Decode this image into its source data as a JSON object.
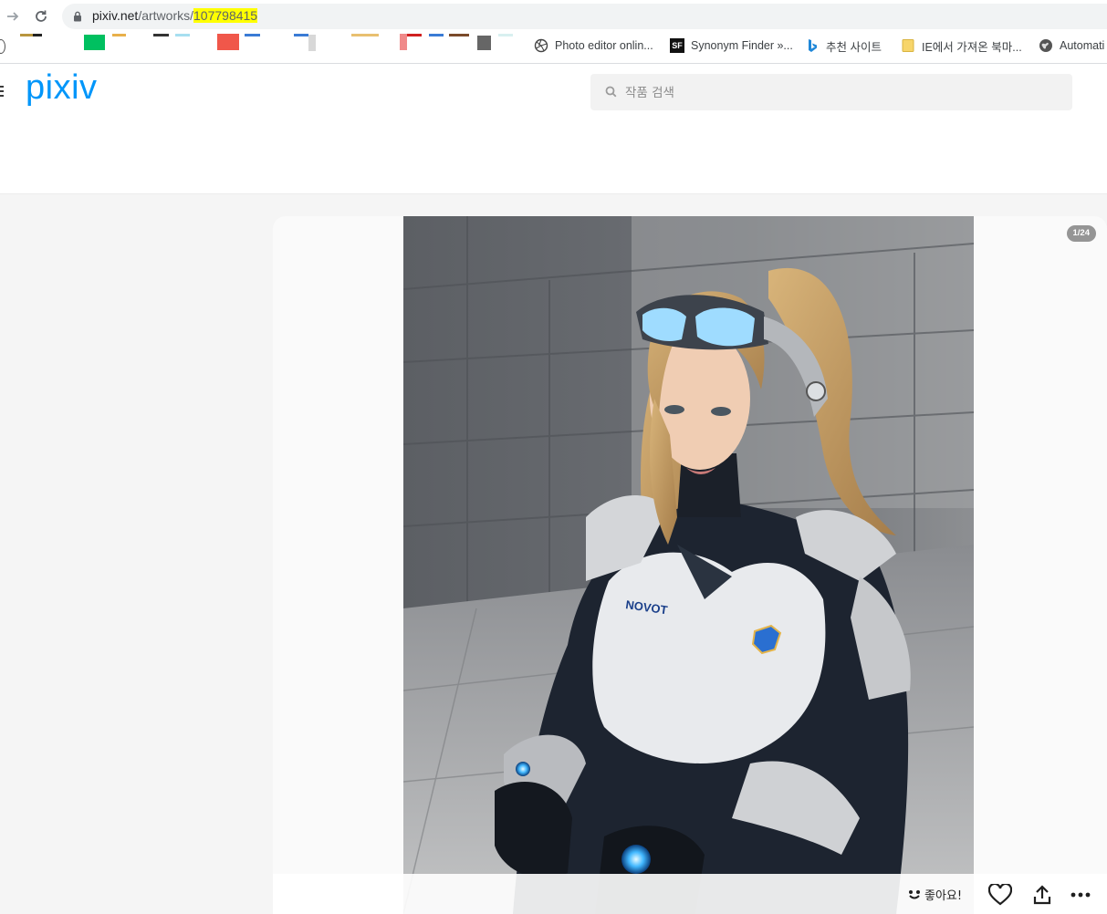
{
  "browser": {
    "url_domain": "pixiv.net",
    "url_path": "/artworks/",
    "url_id": "107798415",
    "bookmarks": [
      {
        "icon": "aperture-icon",
        "label": "Photo editor onlin..."
      },
      {
        "icon": "sf-icon",
        "label": "Synonym Finder »..."
      },
      {
        "icon": "bing-icon",
        "label": "추천 사이트"
      },
      {
        "icon": "folder-icon",
        "label": "IE에서 가져온 북마..."
      },
      {
        "icon": "globe-icon",
        "label": "Automati"
      }
    ]
  },
  "header": {
    "logo": "pixiv",
    "search_placeholder": "작품 검색"
  },
  "artwork": {
    "page_indicator": "1/24",
    "chest_text": "NOVOT",
    "like_label": "좋아요!"
  },
  "colors": {
    "brand": "#0096fa",
    "url_highlight": "#ffff00"
  }
}
